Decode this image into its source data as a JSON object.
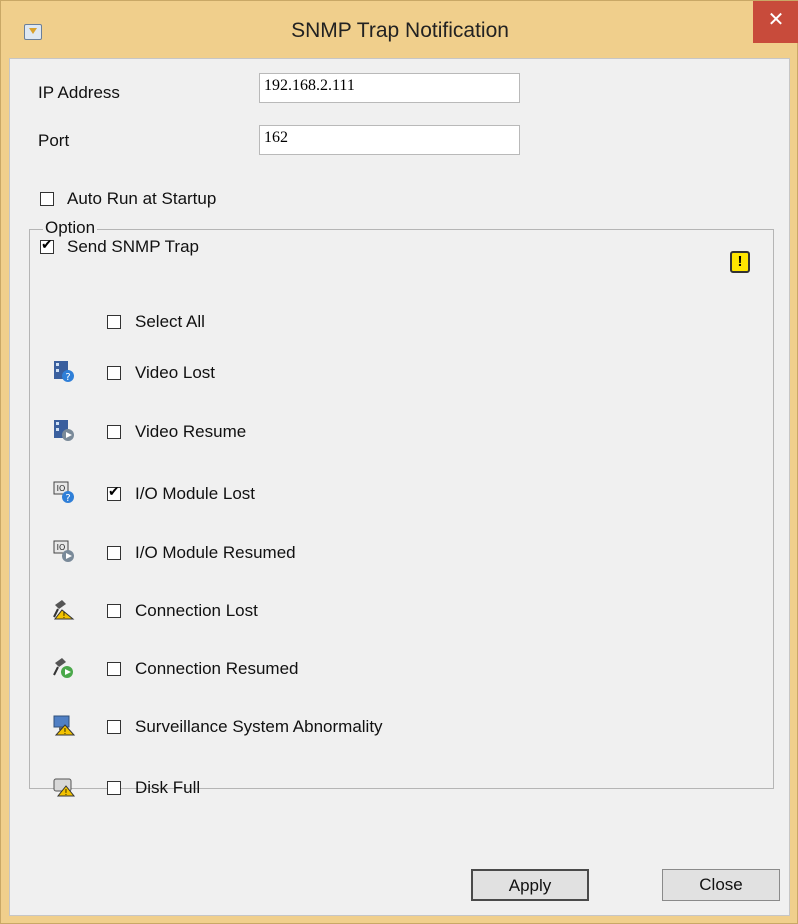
{
  "window": {
    "title": "SNMP Trap Notification",
    "close_glyph": "✕"
  },
  "ip": {
    "label": "IP Address",
    "value": "192.168.2.111"
  },
  "port": {
    "label": "Port",
    "value": "162"
  },
  "auto_run": {
    "label": "Auto Run at Startup",
    "checked": false
  },
  "send_trap": {
    "label": "Send SNMP Trap",
    "checked": true
  },
  "option_group": {
    "title": "Option",
    "select_all": {
      "label": "Select All",
      "checked": false
    },
    "items": [
      {
        "label": "Video Lost",
        "checked": false,
        "icon": "video-lost-icon"
      },
      {
        "label": "Video Resume",
        "checked": false,
        "icon": "video-resume-icon"
      },
      {
        "label": "I/O Module Lost",
        "checked": true,
        "icon": "io-module-lost-icon"
      },
      {
        "label": "I/O Module Resumed",
        "checked": false,
        "icon": "io-module-resumed-icon"
      },
      {
        "label": "Connection Lost",
        "checked": false,
        "icon": "connection-lost-icon"
      },
      {
        "label": "Connection Resumed",
        "checked": false,
        "icon": "connection-resumed-icon"
      },
      {
        "label": "Surveillance System Abnormality",
        "checked": false,
        "icon": "system-abnormality-icon"
      },
      {
        "label": "Disk Full",
        "checked": false,
        "icon": "disk-full-icon"
      }
    ],
    "alert_glyph": "!"
  },
  "buttons": {
    "apply": "Apply",
    "close": "Close"
  }
}
